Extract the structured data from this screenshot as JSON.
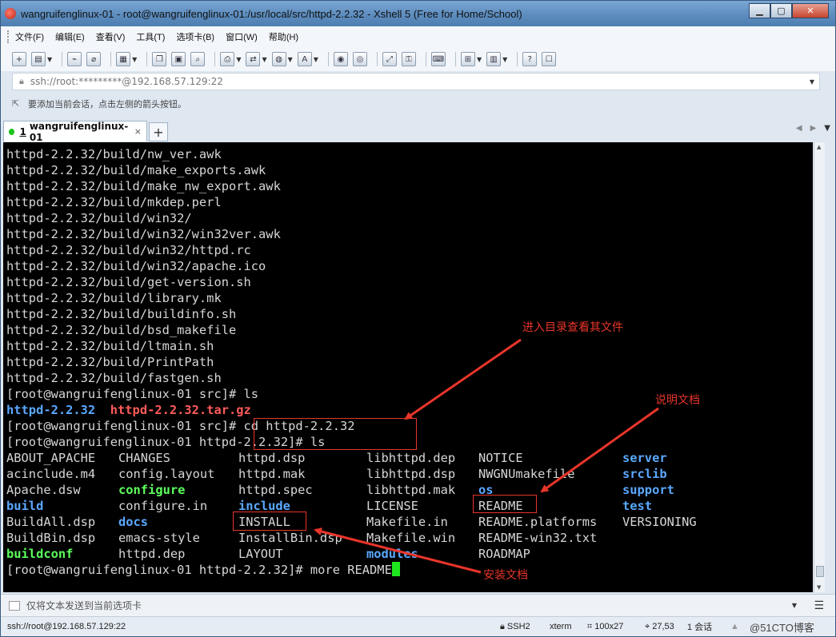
{
  "window": {
    "title": "wangruifenglinux-01 - root@wangruifenglinux-01:/usr/local/src/httpd-2.2.32 - Xshell 5 (Free for Home/School)",
    "min": "▁",
    "max": "▢",
    "close": "✕"
  },
  "menu": {
    "items": [
      "文件(F)",
      "编辑(E)",
      "查看(V)",
      "工具(T)",
      "选项卡(B)",
      "窗口(W)",
      "帮助(H)"
    ]
  },
  "address": {
    "value": "ssh://root:*********@192.168.57.129:22"
  },
  "hint": {
    "text": "要添加当前会话，点击左侧的箭头按钮。"
  },
  "tabs": [
    {
      "number": "1",
      "label": "wangruifenglinux-01",
      "close": "×"
    }
  ],
  "tab_add": "+",
  "terminal": {
    "lines": [
      "httpd-2.2.32/build/nw_ver.awk",
      "httpd-2.2.32/build/make_exports.awk",
      "httpd-2.2.32/build/make_nw_export.awk",
      "httpd-2.2.32/build/mkdep.perl",
      "httpd-2.2.32/build/win32/",
      "httpd-2.2.32/build/win32/win32ver.awk",
      "httpd-2.2.32/build/win32/httpd.rc",
      "httpd-2.2.32/build/win32/apache.ico",
      "httpd-2.2.32/build/get-version.sh",
      "httpd-2.2.32/build/library.mk",
      "httpd-2.2.32/build/buildinfo.sh",
      "httpd-2.2.32/build/bsd_makefile",
      "httpd-2.2.32/build/ltmain.sh",
      "httpd-2.2.32/build/PrintPath",
      "httpd-2.2.32/build/fastgen.sh",
      "[root@wangruifenglinux-01 src]# ls"
    ],
    "ls_src": [
      "httpd-2.2.32",
      "httpd-2.2.32.tar.gz"
    ],
    "cmd_cd": "[root@wangruifenglinux-01 src]# cd httpd-2.2.32",
    "cmd_ls": "[root@wangruifenglinux-01 httpd-2.2.32]# ls",
    "ls_rows": [
      [
        [
          "ABOUT_APACHE",
          ""
        ],
        [
          "CHANGES",
          ""
        ],
        [
          "httpd.dsp",
          ""
        ],
        [
          "libhttpd.dep",
          ""
        ],
        [
          "NOTICE",
          ""
        ],
        [
          "server",
          "b"
        ]
      ],
      [
        [
          "acinclude.m4",
          ""
        ],
        [
          "config.layout",
          ""
        ],
        [
          "httpd.mak",
          ""
        ],
        [
          "libhttpd.dsp",
          ""
        ],
        [
          "NWGNUmakefile",
          ""
        ],
        [
          "srclib",
          "b"
        ]
      ],
      [
        [
          "Apache.dsw",
          ""
        ],
        [
          "configure",
          "g"
        ],
        [
          "httpd.spec",
          ""
        ],
        [
          "libhttpd.mak",
          ""
        ],
        [
          "os",
          "b"
        ],
        [
          "support",
          "b"
        ]
      ],
      [
        [
          "build",
          "b"
        ],
        [
          "configure.in",
          ""
        ],
        [
          "include",
          "b"
        ],
        [
          "LICENSE",
          ""
        ],
        [
          "README",
          ""
        ],
        [
          "test",
          "b"
        ]
      ],
      [
        [
          "BuildAll.dsp",
          ""
        ],
        [
          "docs",
          "b"
        ],
        [
          "INSTALL",
          ""
        ],
        [
          "Makefile.in",
          ""
        ],
        [
          "README.platforms",
          ""
        ],
        [
          "VERSIONING",
          ""
        ]
      ],
      [
        [
          "BuildBin.dsp",
          ""
        ],
        [
          "emacs-style",
          ""
        ],
        [
          "InstallBin.dsp",
          ""
        ],
        [
          "Makefile.win",
          ""
        ],
        [
          "README-win32.txt",
          ""
        ],
        [
          "",
          ""
        ]
      ],
      [
        [
          "buildconf",
          "g"
        ],
        [
          "httpd.dep",
          ""
        ],
        [
          "LAYOUT",
          ""
        ],
        [
          "modules",
          "b"
        ],
        [
          "ROADMAP",
          ""
        ],
        [
          "",
          ""
        ]
      ]
    ],
    "prompt_last": "[root@wangruifenglinux-01 httpd-2.2.32]# more README"
  },
  "annotations": {
    "enter_dir": "进入目录查看其文件",
    "readme": "说明文档",
    "install": "安装文档"
  },
  "compose": {
    "placeholder": "仅将文本发送到当前选项卡"
  },
  "status": {
    "connection": "ssh://root@192.168.57.129:22",
    "protocol": "SSH2",
    "term": "xterm",
    "size": "100x27",
    "cursor": "27,53",
    "sessions": "1 会话",
    "watermark": "@51CTO博客"
  },
  "colors": {
    "dir_blue": "#5aa8ff",
    "archive_red": "#ff5b5b",
    "exec_green": "#5cff5c",
    "annotation_red": "#e8352a"
  }
}
